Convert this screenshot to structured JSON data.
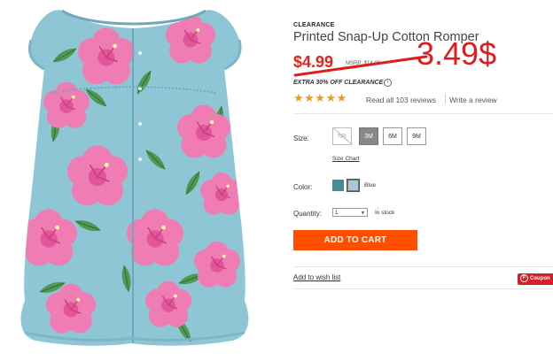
{
  "product": {
    "badge": "CLEARANCE",
    "title": "Printed Snap-Up Cotton Romper",
    "old_price": "$4.99",
    "msrp": "MSRP: $14.00",
    "handwritten_price": "3.49$",
    "clearance_note": "EXTRA 30% OFF CLEARANCE",
    "info_icon": "i"
  },
  "rating": {
    "stars": "★★★★★",
    "reviews_link": "Read all 103 reviews",
    "write_review": "Write a review"
  },
  "size": {
    "label": "Size:",
    "options": [
      "NB",
      "3M",
      "6M",
      "9M"
    ],
    "selected": "3M",
    "unavailable": "NB",
    "chart_link": "Size Chart"
  },
  "color": {
    "label": "Color:",
    "selected_name": "Blue",
    "swatches": [
      "#3f8e9a",
      "#a8c8d6"
    ]
  },
  "quantity": {
    "label": "Quantity:",
    "value": "1",
    "stock": "In stock"
  },
  "actions": {
    "add_to_cart": "ADD TO CART",
    "wishlist": "Add to wish list",
    "coupon": "Coupon"
  },
  "colors": {
    "price_red": "#e1251b",
    "cta_orange": "#ff4e00",
    "star_orange": "#f29a1e",
    "romper_blue": "#8fc6d6",
    "flower_pink": "#f07cb4",
    "leaf_green": "#4f9a52"
  }
}
